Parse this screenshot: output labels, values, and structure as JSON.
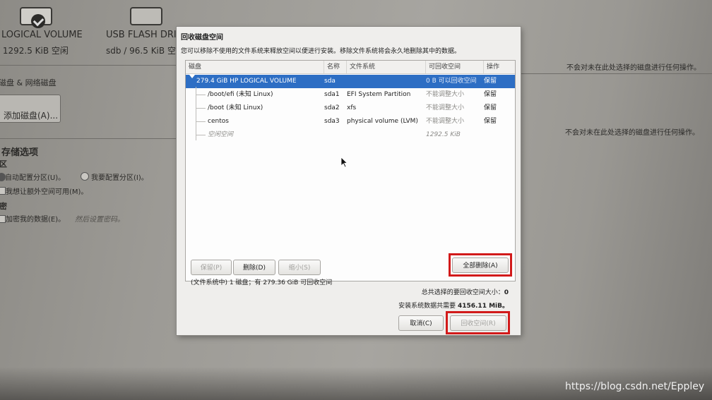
{
  "background": {
    "disk1": {
      "name": "LOGICAL VOLUME",
      "detail": "/ 1292.5 KiB 空闲"
    },
    "disk2": {
      "name": "USB FLASH DRI",
      "detail": "sdb / 96.5 KiB 空"
    },
    "section_label": "磁盘 & 网络磁盘",
    "add_disk_button": "添加磁盘(A)...",
    "storage_title": "存储选项",
    "partition_label": "区",
    "auto_partition": "自动配置分区(U)。",
    "manual_partition": "我要配置分区(I)。",
    "extra_space": "我想让额外空间可用(M)。",
    "encryption_label": "密",
    "encrypt_data": "加密我的数据(E)。",
    "encrypt_hint": "然后设置密码。",
    "right_note_1": "不会对未在此处选择的磁盘进行任何操作。",
    "right_note_2": "不会对未在此处选择的磁盘进行任何操作。",
    "watermark": "https://blog.csdn.net/Eppley"
  },
  "dialog": {
    "title": "回收磁盘空间",
    "description": "您可以移除不使用的文件系统来释放空间以便进行安装。移除文件系统将会永久地删除其中的数据。",
    "columns": {
      "disk": "磁盘",
      "name": "名称",
      "filesystem": "文件系统",
      "reclaimable": "可回收空间",
      "action": "操作"
    },
    "rows": [
      {
        "disk": "279.4 GiB HP LOGICAL VOLUME",
        "name": "sda",
        "filesystem": "",
        "reclaimable": "0 B 可以回收空间",
        "action": "保留"
      },
      {
        "disk": "/boot/efi (未知 Linux)",
        "name": "sda1",
        "filesystem": "EFI System Partition",
        "reclaimable": "不能调整大小",
        "action": "保留"
      },
      {
        "disk": "/boot (未知 Linux)",
        "name": "sda2",
        "filesystem": "xfs",
        "reclaimable": "不能调整大小",
        "action": "保留"
      },
      {
        "disk": "centos",
        "name": "sda3",
        "filesystem": "physical volume (LVM)",
        "reclaimable": "不能调整大小",
        "action": "保留"
      },
      {
        "disk": "空闲空间",
        "name": "",
        "filesystem": "",
        "reclaimable": "1292.5 KiB",
        "action": ""
      }
    ],
    "buttons": {
      "preserve": "保留(P)",
      "delete": "删除(D)",
      "shrink": "缩小(S)",
      "delete_all": "全部删除(A)",
      "cancel": "取消(C)",
      "reclaim": "回收空间(R)"
    },
    "summary": "(文件系统中) 1 磁盘；有 279.36 GiB 可回收空间",
    "selected_total_label": "总共选择的要回收空间大小：",
    "selected_total_value": "0",
    "required_label": "安装系统数据共需要",
    "required_value": "4156.11 MiB。"
  }
}
